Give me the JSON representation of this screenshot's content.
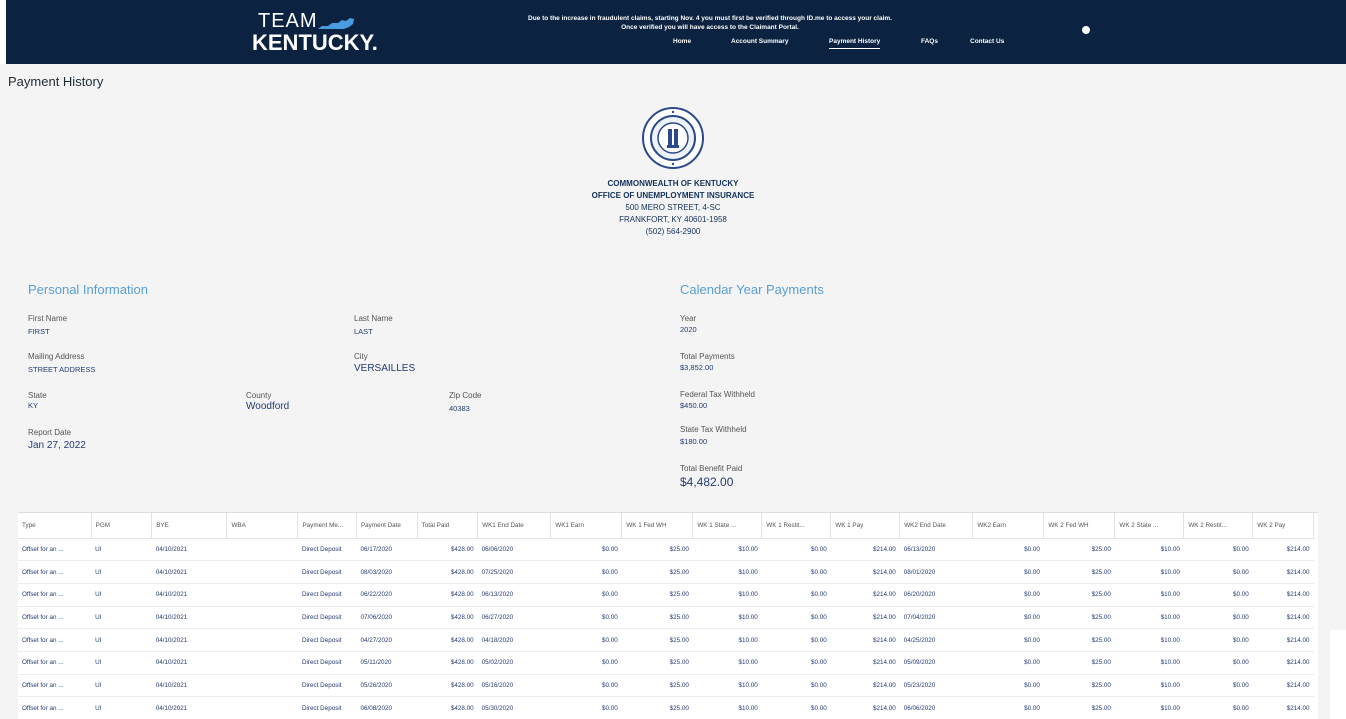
{
  "header": {
    "logo_team": "TEAM",
    "logo_state": "KENTUCKY.",
    "notice_line1": "Due to the increase in fraudulent claims, starting Nov. 4 you must first be verified through ID.me to access your claim.",
    "notice_line2": "Once verified you will have access to the Claimant Portal.",
    "nav": [
      {
        "label": "Home"
      },
      {
        "label": "Account Summary"
      },
      {
        "label": "Payment History"
      },
      {
        "label": "FAQs"
      },
      {
        "label": "Contact Us"
      }
    ],
    "colors": {
      "bar": "#0b2340",
      "accent": "#5a9fd3"
    }
  },
  "page_title": "Payment History",
  "agency": {
    "line1": "COMMONWEALTH OF KENTUCKY",
    "line2": "OFFICE OF UNEMPLOYMENT INSURANCE",
    "line3": "500 MERO STREET, 4-SC",
    "line4": "FRANKFORT, KY 40601-1958",
    "line5": "(502) 564-2900",
    "seal_icon": "state-seal-icon"
  },
  "personal": {
    "title": "Personal Information",
    "first_name_label": "First Name",
    "first_name": "FIRST",
    "last_name_label": "Last Name",
    "last_name": "LAST",
    "mailing_label": "Mailing Address",
    "mailing": "STREET ADDRESS",
    "city_label": "City",
    "city": "VERSAILLES",
    "state_label": "State",
    "state": "KY",
    "county_label": "County",
    "county": "Woodford",
    "zip_label": "Zip Code",
    "zip": "40383",
    "report_label": "Report Date",
    "report": "Jan 27, 2022"
  },
  "calendar": {
    "title": "Calendar Year Payments",
    "year_label": "Year",
    "year": "2020",
    "total_payments_label": "Total Payments",
    "total_payments": "$3,852.00",
    "fed_label": "Federal Tax Withheld",
    "fed": "$450.00",
    "state_label": "State Tax Withheld",
    "state": "$180.00",
    "benefit_label": "Total Benefit Paid",
    "benefit": "$4,482.00"
  },
  "table": {
    "headers": [
      "Type",
      "PGM",
      "BYE",
      "WBA",
      "Payment Me...",
      "Payment Date",
      "Total Paid",
      "WK1 End Date",
      "WK1 Earn",
      "WK 1 Fed WH",
      "WK 1 State ...",
      "WK 1 Restit...",
      "WK 1 Pay",
      "WK2 End Date",
      "WK2 Earn",
      "WK 2 Fed WH",
      "WK 2 State ...",
      "WK 2 Restit...",
      "WK 2 Pay"
    ],
    "rows": [
      [
        "Offset for an ...",
        "UI",
        "04/10/2021",
        "",
        "Direct Deposit",
        "06/17/2020",
        "$428.00",
        "06/06/2020",
        "$0.00",
        "$25.00",
        "$10.00",
        "$0.00",
        "$214.00",
        "06/13/2020",
        "$0.00",
        "$25.00",
        "$10.00",
        "$0.00",
        "$214.00"
      ],
      [
        "Offset for an ...",
        "UI",
        "04/10/2021",
        "",
        "Direct Deposit",
        "08/03/2020",
        "$428.00",
        "07/25/2020",
        "$0.00",
        "$25.00",
        "$10.00",
        "$0.00",
        "$214.00",
        "08/01/2020",
        "$0.00",
        "$25.00",
        "$10.00",
        "$0.00",
        "$214.00"
      ],
      [
        "Offset for an ...",
        "UI",
        "04/10/2021",
        "",
        "Direct Deposit",
        "06/22/2020",
        "$428.00",
        "06/13/2020",
        "$0.00",
        "$25.00",
        "$10.00",
        "$0.00",
        "$214.00",
        "06/20/2020",
        "$0.00",
        "$25.00",
        "$10.00",
        "$0.00",
        "$214.00"
      ],
      [
        "Offset for an ...",
        "UI",
        "04/10/2021",
        "",
        "Direct Deposit",
        "07/06/2020",
        "$428.00",
        "06/27/2020",
        "$0.00",
        "$25.00",
        "$10.00",
        "$0.00",
        "$214.00",
        "07/04/2020",
        "$0.00",
        "$25.00",
        "$10.00",
        "$0.00",
        "$214.00"
      ],
      [
        "Offset for an ...",
        "UI",
        "04/10/2021",
        "",
        "Direct Deposit",
        "04/27/2020",
        "$428.00",
        "04/18/2020",
        "$0.00",
        "$25.00",
        "$10.00",
        "$0.00",
        "$214.00",
        "04/25/2020",
        "$0.00",
        "$25.00",
        "$10.00",
        "$0.00",
        "$214.00"
      ],
      [
        "Offset for an ...",
        "UI",
        "04/10/2021",
        "",
        "Direct Deposit",
        "05/11/2020",
        "$428.00",
        "05/02/2020",
        "$0.00",
        "$25.00",
        "$10.00",
        "$0.00",
        "$214.00",
        "05/09/2020",
        "$0.00",
        "$25.00",
        "$10.00",
        "$0.00",
        "$214.00"
      ],
      [
        "Offset for an ...",
        "UI",
        "04/10/2021",
        "",
        "Direct Deposit",
        "05/26/2020",
        "$428.00",
        "05/16/2020",
        "$0.00",
        "$25.00",
        "$10.00",
        "$0.00",
        "$214.00",
        "05/23/2020",
        "$0.00",
        "$25.00",
        "$10.00",
        "$0.00",
        "$214.00"
      ],
      [
        "Offset for an ...",
        "UI",
        "04/10/2021",
        "",
        "Direct Deposit",
        "06/08/2020",
        "$428.00",
        "05/30/2020",
        "$0.00",
        "$25.00",
        "$10.00",
        "$0.00",
        "$214.00",
        "06/06/2020",
        "$0.00",
        "$25.00",
        "$10.00",
        "$0.00",
        "$214.00"
      ]
    ]
  }
}
